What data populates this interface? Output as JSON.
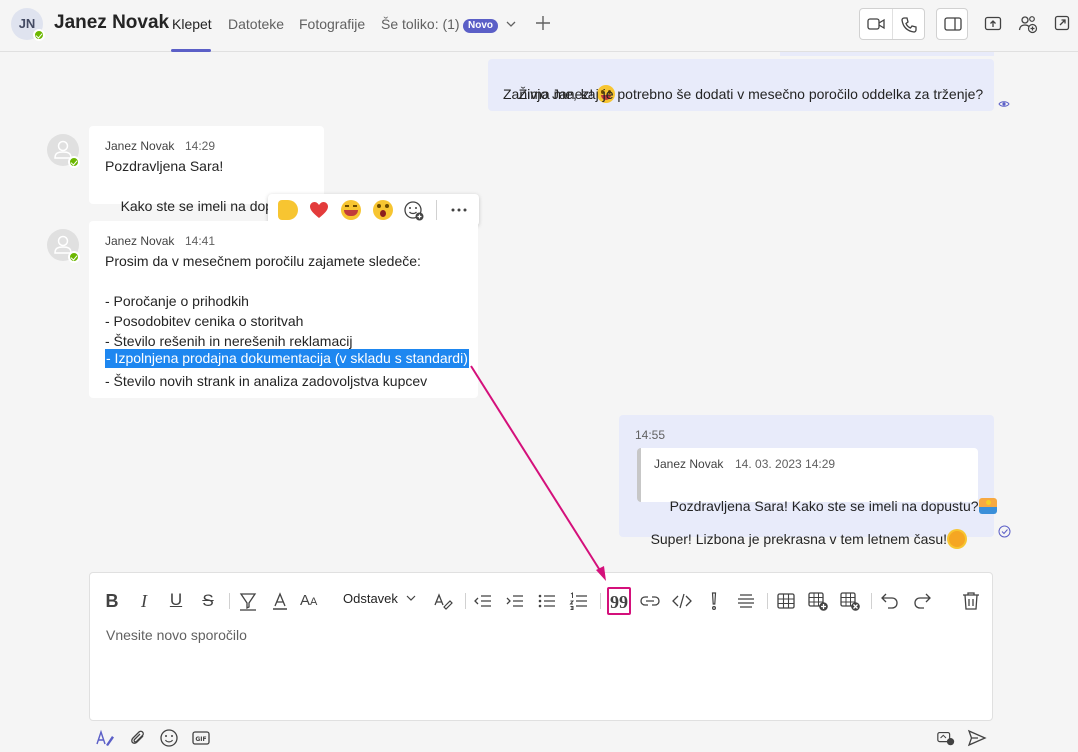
{
  "header": {
    "avatar_initials": "JN",
    "name": "Janez Novak",
    "tabs": [
      "Klepet",
      "Datoteke",
      "Fotografije",
      "Še toliko: (1)"
    ],
    "badge": "Novo"
  },
  "messages": {
    "m1": {
      "line1": "Živjo Janez! ",
      "line2": "Zanima me, kaj je potrebno še dodati v mesečno poročilo oddelka za trženje?"
    },
    "m2": {
      "sender": "Janez Novak",
      "time": "14:29",
      "line1": "Pozdravljena Sara!",
      "line2": "Kako ste se imeli na dopustu?"
    },
    "m3": {
      "sender": "Janez Novak",
      "time": "14:41",
      "lines": [
        "Prosim da v mesečnem poročilu zajamete sledeče:",
        "",
        "- Poročanje o prihodkih",
        "- Posodobitev cenika o storitvah",
        "- Število rešenih in nerešenih reklamacij",
        "- Izpolnjena prodajna dokumentacija (v skladu s standardi)",
        "- Število novih strank in analiza zadovoljstva kupcev"
      ]
    },
    "m4": {
      "time": "14:55",
      "quote_sender": "Janez Novak",
      "quote_time": "14. 03. 2023 14:29",
      "quote_text": "Pozdravljena Sara! Kako ste se imeli na dopustu?",
      "text": "Super! Lizbona je prekrasna v tem letnem času!"
    }
  },
  "compose": {
    "paragraph_label": "Odstavek",
    "placeholder": "Vnesite novo sporočilo"
  },
  "colors": {
    "accent": "#5b5fc7",
    "highlight": "#1e87f0",
    "annotation": "#d4107b",
    "presence": "#6bb700"
  }
}
